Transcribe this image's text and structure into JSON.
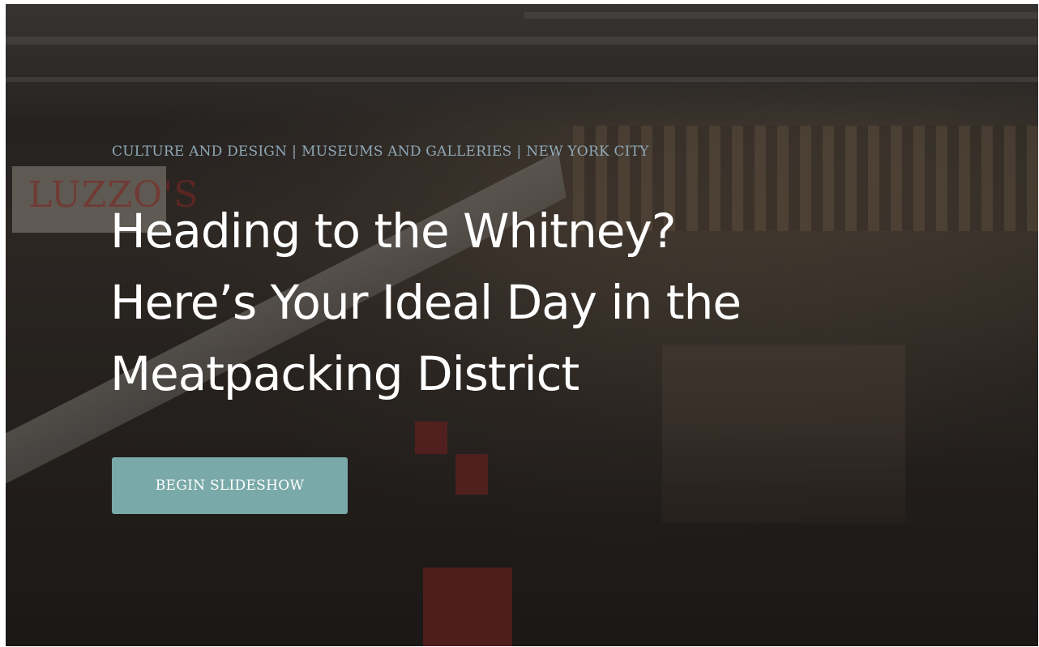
{
  "hero": {
    "categories": [
      {
        "label": "CULTURE AND DESIGN"
      },
      {
        "label": "MUSEUMS AND GALLERIES"
      },
      {
        "label": "NEW YORK CITY"
      }
    ],
    "separator": "|",
    "headline_lines": [
      "Heading to the Whitney?",
      "Here’s Your Ideal Day in the",
      "Meatpacking District"
    ],
    "cta_label": "BEGIN SLIDESHOW",
    "background_sign_text": "LUZZO'S"
  },
  "colors": {
    "headline": "#ffffff",
    "category_link": "#8fa9b8",
    "cta_background": "#79a9a8",
    "cta_text": "#ffffff"
  }
}
